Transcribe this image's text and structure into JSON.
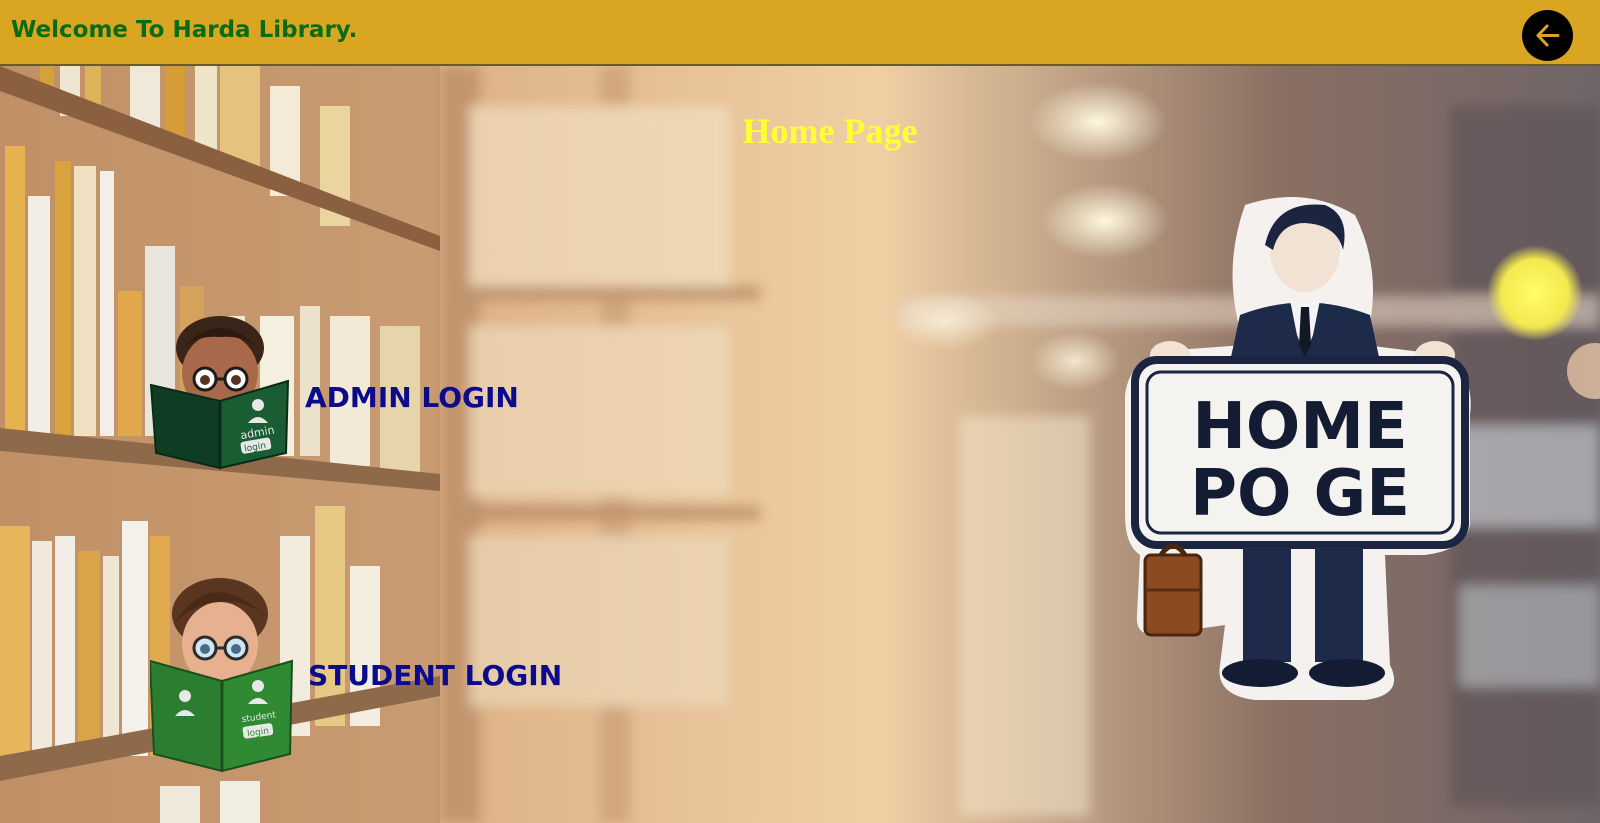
{
  "header": {
    "welcome_text": "Welcome To Harda Library.",
    "back_icon": "arrow-left-icon"
  },
  "main": {
    "title": "Home Page",
    "admin_login_label": "ADMIN LOGIN",
    "student_login_label": "STUDENT LOGIN",
    "admin_book_text_1": "admin",
    "admin_book_text_2": "login",
    "student_book_text_1": "student",
    "student_book_text_2": "login",
    "sign_line_1": "HOME",
    "sign_line_2": "PO GE"
  },
  "colors": {
    "header_bg": "#daa520",
    "welcome_text": "#0a6b16",
    "title": "#ffff33",
    "login_label": "#0b0b8c"
  }
}
